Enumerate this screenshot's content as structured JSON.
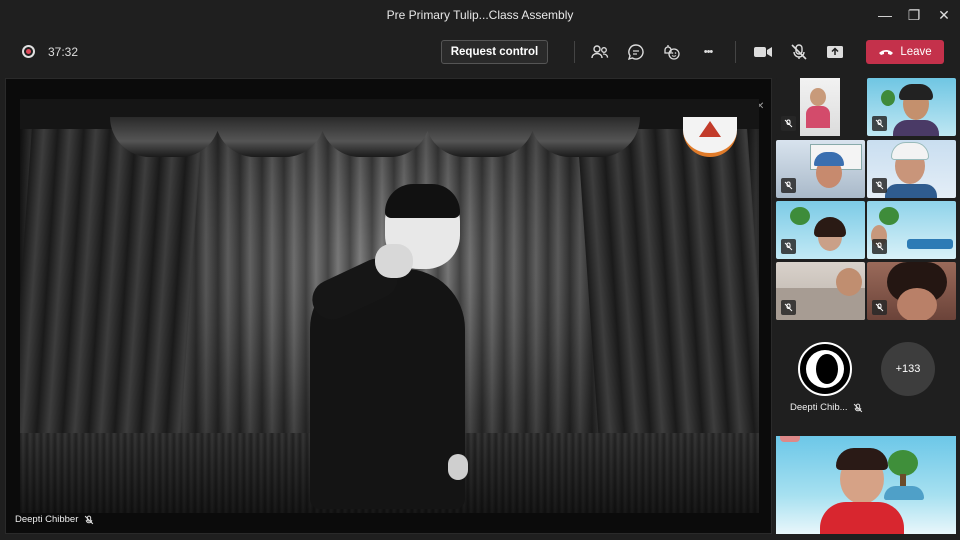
{
  "window": {
    "title": "Pre Primary Tulip...Class Assembly",
    "minimize_glyph": "—",
    "maximize_glyph": "❐",
    "close_glyph": "✕"
  },
  "toolbar": {
    "elapsed": "37:32",
    "request_control_label": "Request control",
    "leave_label": "Leave",
    "colors": {
      "leave": "#c4314b",
      "recording": "#e04a5a"
    },
    "icons": [
      "people-icon",
      "chat-icon",
      "reactions-icon",
      "more-options-icon",
      "camera-icon",
      "mic-muted-icon",
      "share-screen-icon",
      "phone-icon"
    ],
    "more_glyph": "•••"
  },
  "stage": {
    "presenter_name": "Deepti Chibber",
    "screen_controls": [
      "—",
      "❐",
      "✕"
    ]
  },
  "participants": {
    "overflow_count": "+133",
    "avatar_name": "Deepti Chib..."
  }
}
